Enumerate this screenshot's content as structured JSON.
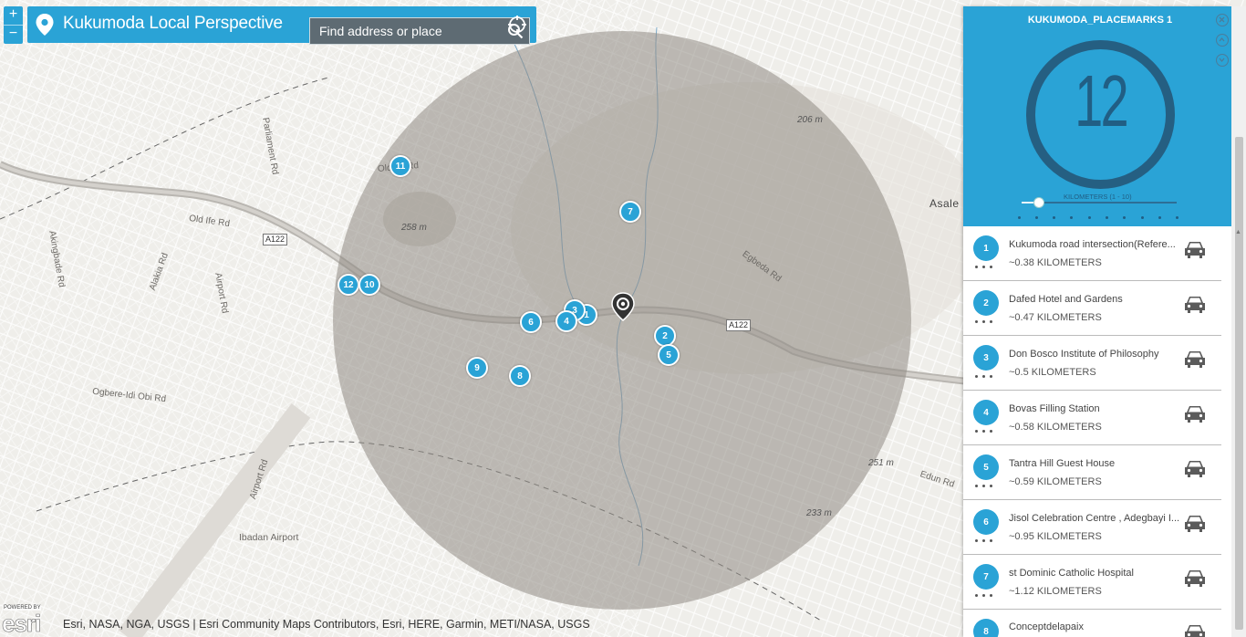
{
  "header": {
    "title": "Kukumoda Local Perspective",
    "search_placeholder": "Find address or place",
    "zoom_in": "+",
    "zoom_out": "−"
  },
  "map": {
    "roads": [
      "Parliament Rd",
      "Old Ife Rd",
      "Old Ife Rd",
      "Akingbade Rd",
      "Alakia Rd",
      "Airport Rd",
      "Ogbere-Idi Obi Rd",
      "Airport Rd",
      "Egbeda Rd",
      "Edun Rd"
    ],
    "highway_shields": [
      "A122",
      "A122"
    ],
    "places": [
      "Ibadan Airport",
      "Asale"
    ],
    "elevations": [
      "206 m",
      "258 m",
      "251 m",
      "233 m"
    ],
    "markers": [
      "11",
      "7",
      "12",
      "10",
      "3",
      "1",
      "4",
      "6",
      "2",
      "5",
      "9",
      "8"
    ]
  },
  "attribution": {
    "powered_by": "POWERED BY",
    "logo": "esri",
    "text": "Esri, NASA, NGA, USGS | Esri Community Maps Contributors, Esri, HERE, Garmin, METI/NASA, USGS"
  },
  "panel": {
    "title": "KUKUMODA_PLACEMARKS 1",
    "count": "12",
    "slider_label": "KILOMETERS (1 - 10)",
    "slider_value": 2,
    "slider_min": 1,
    "slider_max": 10,
    "places": [
      {
        "num": "1",
        "name": "Kukumoda road intersection(Refere...",
        "dist": "~0.38 KILOMETERS"
      },
      {
        "num": "2",
        "name": "Dafed Hotel and Gardens",
        "dist": "~0.47 KILOMETERS"
      },
      {
        "num": "3",
        "name": "Don Bosco Institute of Philosophy",
        "dist": "~0.5 KILOMETERS"
      },
      {
        "num": "4",
        "name": "Bovas Filling Station",
        "dist": "~0.58 KILOMETERS"
      },
      {
        "num": "5",
        "name": "Tantra Hill Guest House",
        "dist": "~0.59 KILOMETERS"
      },
      {
        "num": "6",
        "name": "Jisol Celebration Centre , Adegbayi I...",
        "dist": "~0.95 KILOMETERS"
      },
      {
        "num": "7",
        "name": "st Dominic Catholic Hospital",
        "dist": "~1.12 KILOMETERS"
      },
      {
        "num": "8",
        "name": "Conceptdelapaix",
        "dist": ""
      }
    ]
  },
  "colors": {
    "accent": "#2aa3d6",
    "ring": "#255f82",
    "buffer": "#8f8a84"
  }
}
